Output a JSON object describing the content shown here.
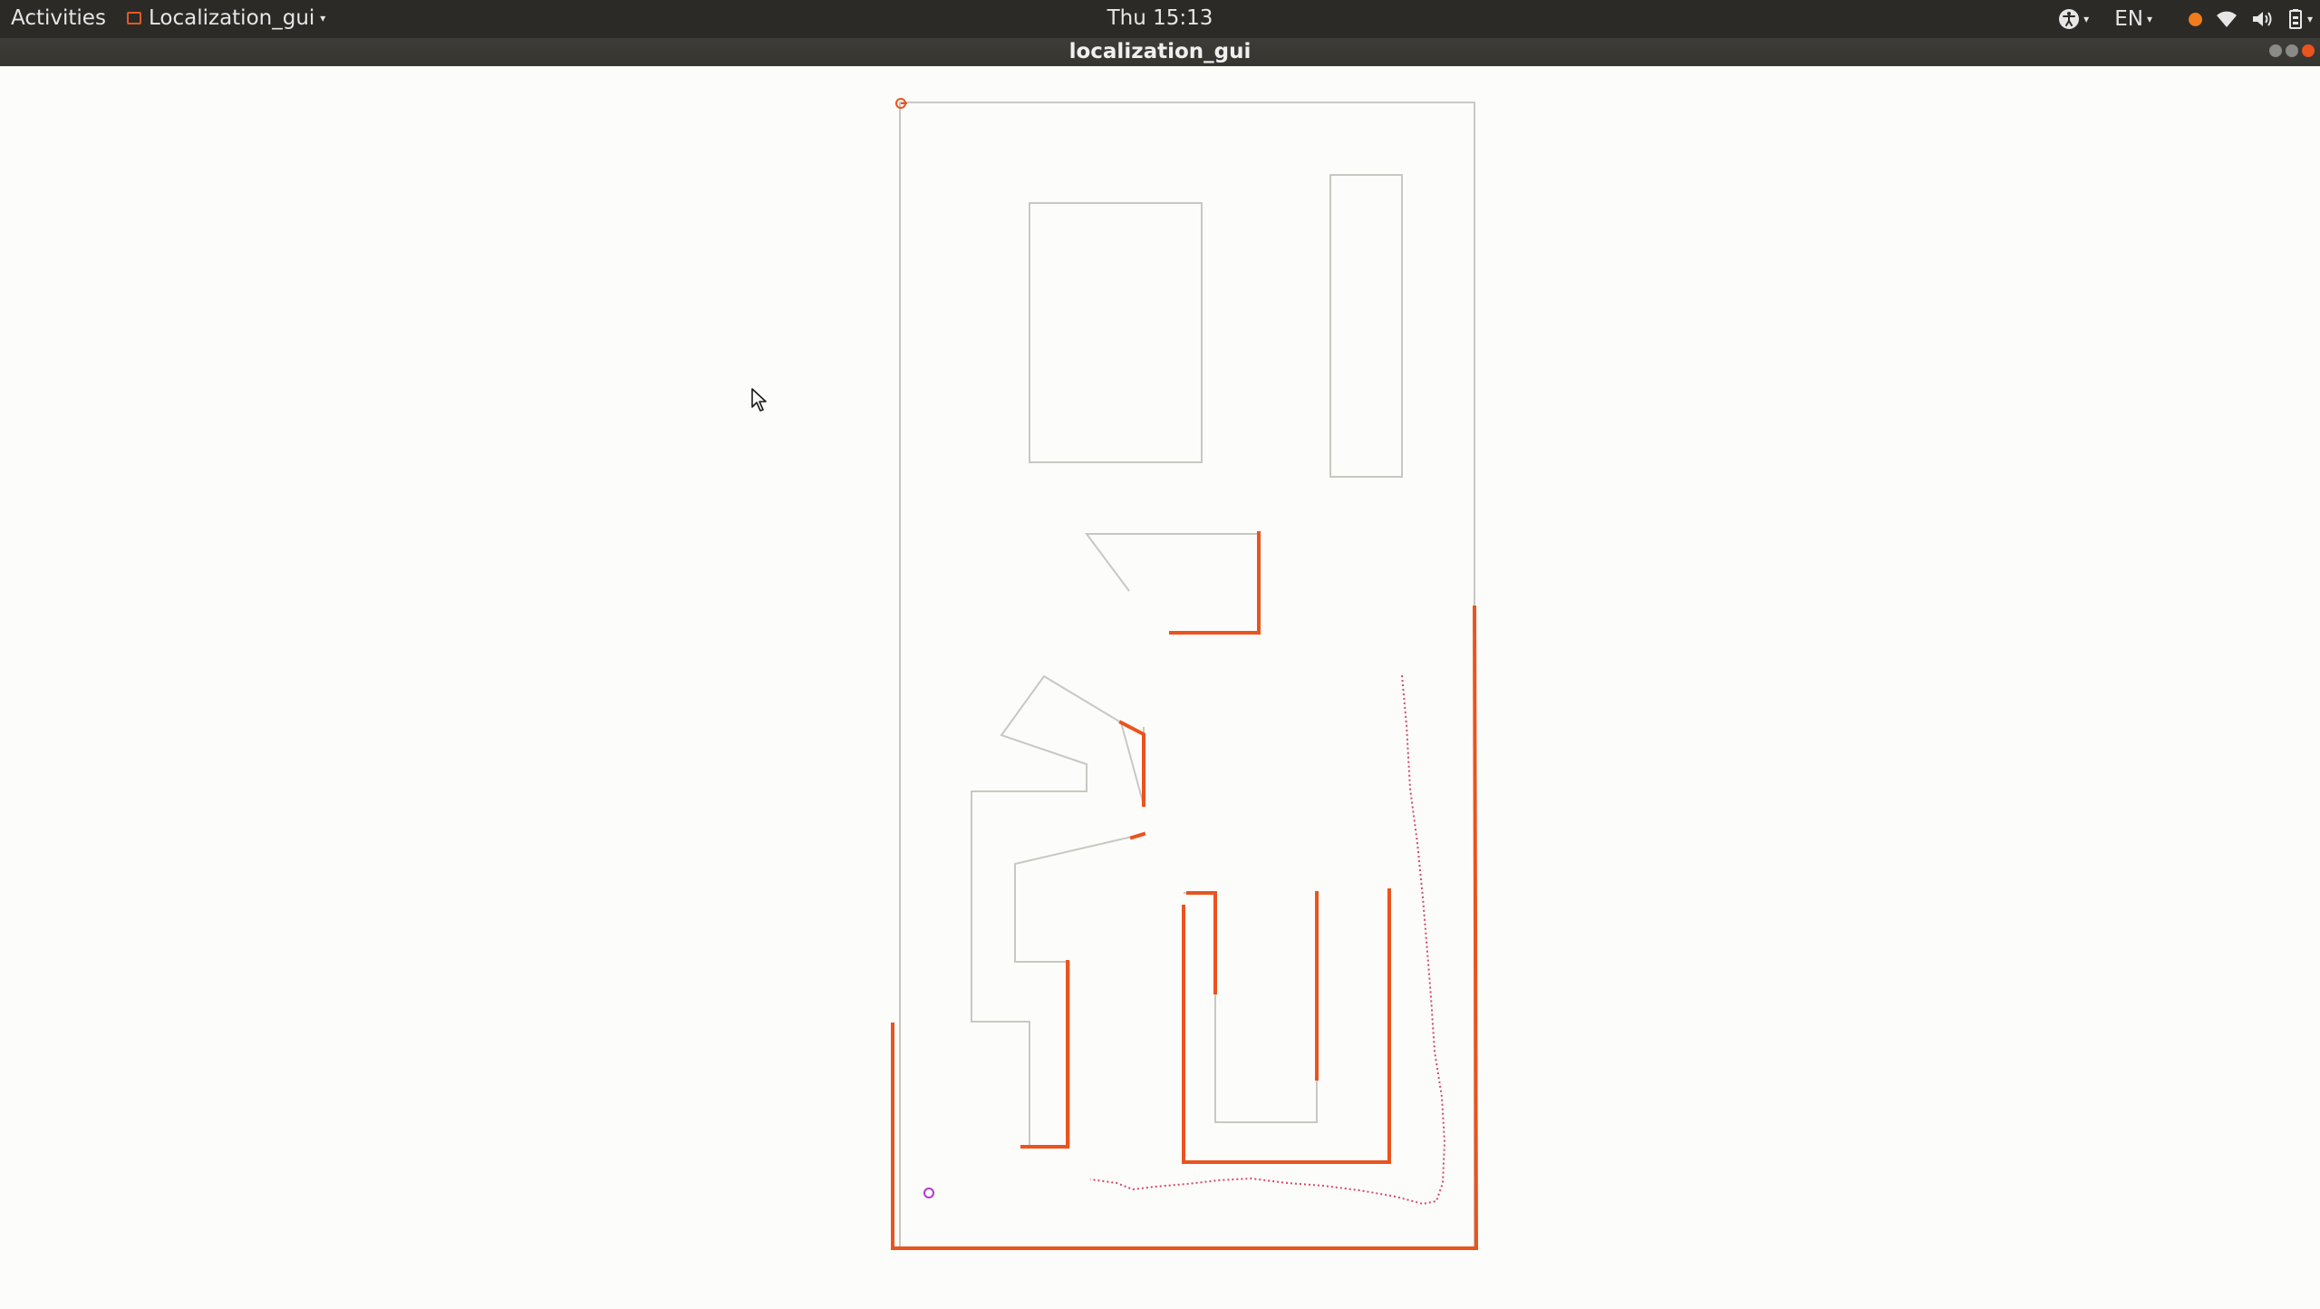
{
  "topbar": {
    "activities_label": "Activities",
    "app_menu_label": "Localization_gui",
    "clock": "Thu 15:13",
    "language": "EN"
  },
  "window": {
    "title": "localization_gui"
  },
  "colors": {
    "accent": "#e9541f",
    "map_outline": "#c8c8c2",
    "particle_cloud": "#d24a6a",
    "robot_marker": "#b03ad0",
    "background": "#fcfcfa"
  }
}
